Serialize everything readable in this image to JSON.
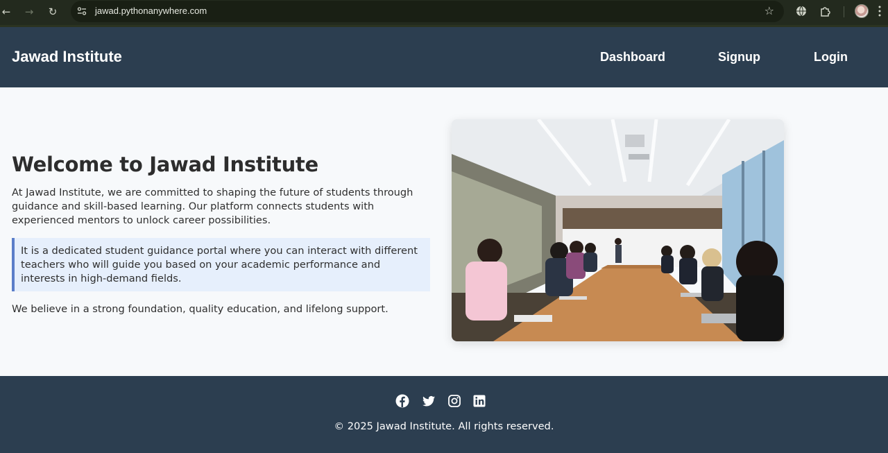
{
  "browser": {
    "url": "jawad.pythonanywhere.com",
    "icons": [
      "back-icon",
      "forward-icon",
      "reload-icon",
      "site-settings-icon",
      "bookmark-star-icon",
      "translate-icon",
      "extensions-icon",
      "profile-avatar",
      "menu-icon"
    ]
  },
  "header": {
    "brand": "Jawad Institute",
    "nav": [
      "Dashboard",
      "Signup",
      "Login"
    ]
  },
  "hero": {
    "title": "Welcome to Jawad Institute",
    "intro": "At Jawad Institute, we are committed to shaping the future of students through guidance and skill-based learning. Our platform connects students with experienced mentors to unlock career possibilities.",
    "callout": "It is a dedicated student guidance portal where you can interact with different teachers who will guide you based on your academic performance and interests in high-demand fields.",
    "closing": "We believe in a strong foundation, quality education, and lifelong support."
  },
  "footer": {
    "social": [
      "facebook-icon",
      "twitter-icon",
      "instagram-icon",
      "linkedin-icon"
    ],
    "copyright": "© 2025 Jawad Institute. All rights reserved."
  },
  "colors": {
    "header_bg": "#2c3e50",
    "page_bg": "#f7f9fb",
    "callout_bg": "#e6effc",
    "callout_border": "#5b7ec9"
  }
}
